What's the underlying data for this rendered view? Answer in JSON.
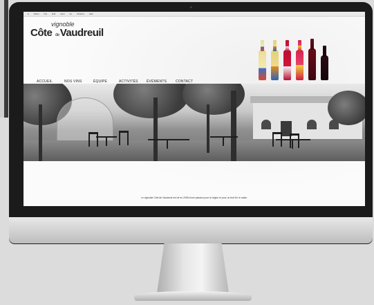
{
  "site": {
    "logo_small": "vignoble",
    "logo_cote": "Côte",
    "logo_de": "de",
    "logo_vaudreuil": "Vaudreuil"
  },
  "macos_menubar": {
    "items": [
      "Safari",
      "File",
      "Edit",
      "View",
      "Go",
      "Window",
      "Help"
    ]
  },
  "nav": {
    "items": [
      "ACCUEIL",
      "NOS VINS",
      "ÉQUIPE",
      "ACTIVITÉS",
      "ÉVÉMENTS",
      "CONTACT"
    ]
  },
  "bottles": {
    "colors": [
      "#f2e7a5",
      "#e9dd8c",
      "#c4123a",
      "#d9214f",
      "#7a0e1e",
      "#2a0a12"
    ]
  },
  "footer": {
    "caption": "Le vignoble Côte de Vaudreuil est né en 2006 d’une passion pour la région et pour un fruit fin: le raisin."
  },
  "colors": {
    "accent": "#222222",
    "bezel": "#1b1b1b"
  }
}
